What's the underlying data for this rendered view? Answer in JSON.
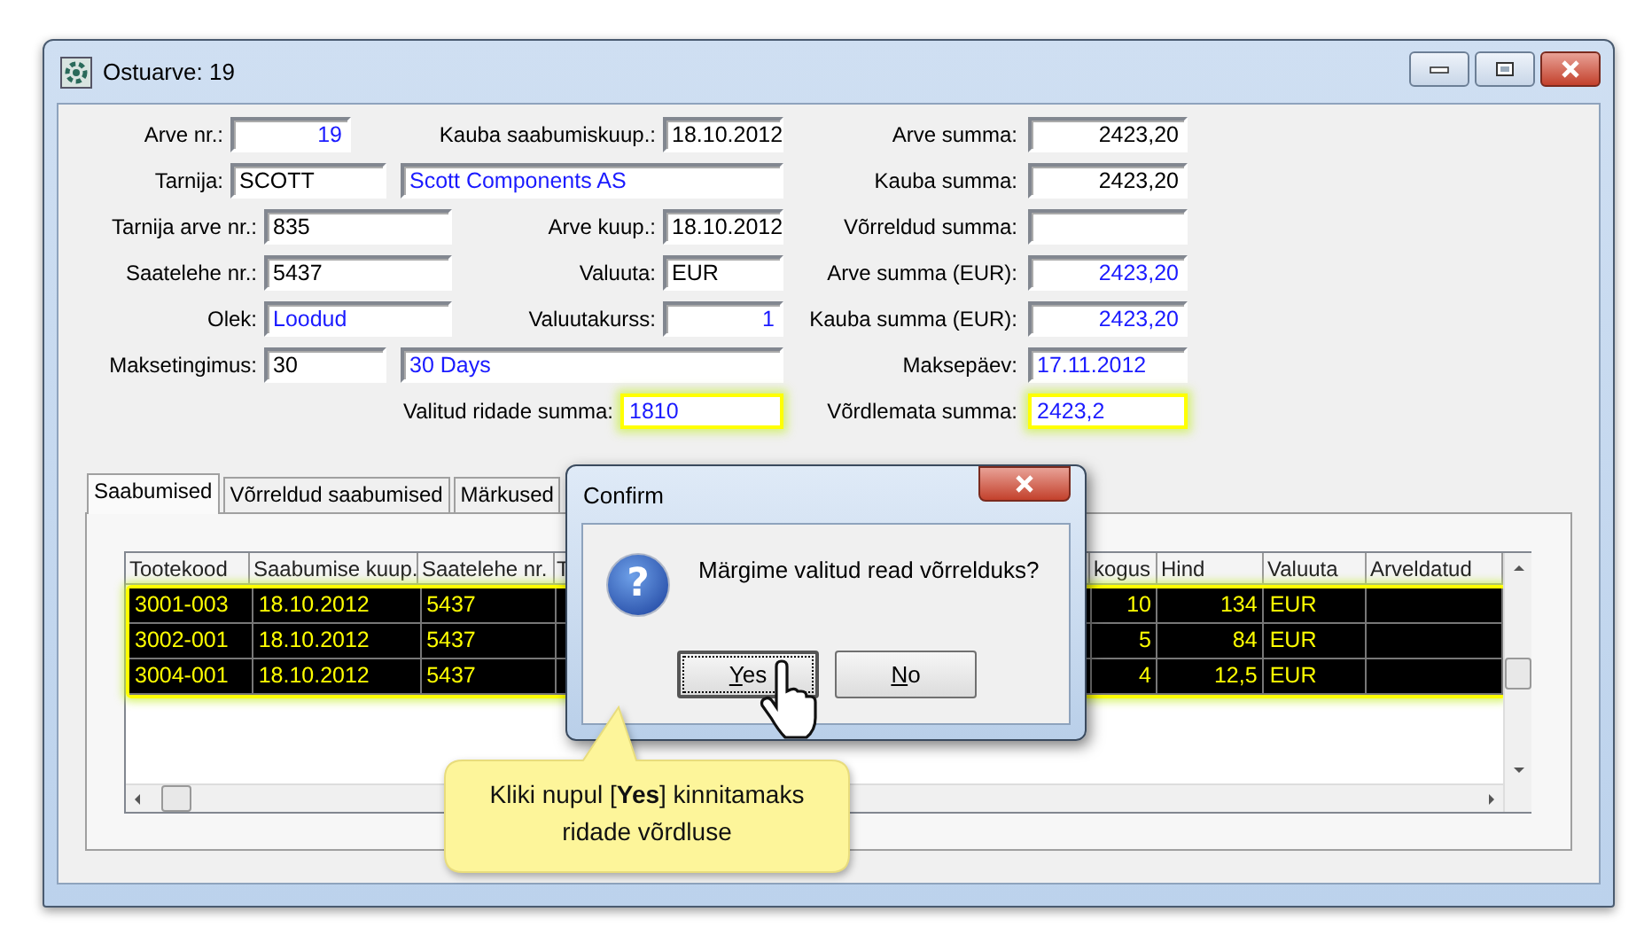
{
  "window": {
    "title": "Ostuarve: 19"
  },
  "form": {
    "left_rows": [
      [
        {
          "kind": "label",
          "text": "Arve nr.:"
        },
        {
          "kind": "number-field",
          "value": "19",
          "readonly": true,
          "highlighted": false
        },
        {
          "kind": "label",
          "text": "Kauba saabumiskuup.:"
        },
        {
          "kind": "field",
          "value": "18.10.2012",
          "readonly": false,
          "highlighted": false
        }
      ],
      [
        {
          "kind": "label",
          "text": "Tarnija:"
        },
        {
          "kind": "field",
          "value": "SCOTT",
          "readonly": false,
          "highlighted": false
        },
        {
          "kind": "field",
          "value": "Scott Components AS",
          "readonly": true,
          "highlighted": false
        }
      ],
      [
        {
          "kind": "label",
          "text": "Tarnija arve nr.:"
        },
        {
          "kind": "field",
          "value": "835",
          "readonly": false,
          "highlighted": false
        },
        {
          "kind": "label",
          "text": "Arve kuup.:"
        },
        {
          "kind": "field",
          "value": "18.10.2012",
          "readonly": false,
          "highlighted": false
        }
      ],
      [
        {
          "kind": "label",
          "text": "Saatelehe nr.:"
        },
        {
          "kind": "field",
          "value": "5437",
          "readonly": false,
          "highlighted": false
        },
        {
          "kind": "label",
          "text": "Valuuta:"
        },
        {
          "kind": "field",
          "value": "EUR",
          "readonly": false,
          "highlighted": false
        }
      ],
      [
        {
          "kind": "label",
          "text": "Olek:"
        },
        {
          "kind": "field",
          "value": "Loodud",
          "readonly": true,
          "highlighted": false
        },
        {
          "kind": "label",
          "text": "Valuutakurss:"
        },
        {
          "kind": "number-field",
          "value": "1",
          "readonly": true,
          "highlighted": false
        }
      ],
      [
        {
          "kind": "label",
          "text": "Maksetingimus:"
        },
        {
          "kind": "field",
          "value": "30",
          "readonly": false,
          "highlighted": false
        },
        {
          "kind": "field",
          "value": "30 Days",
          "readonly": true,
          "highlighted": false
        }
      ],
      [
        {
          "kind": "label",
          "text": "Valitud ridade summa:"
        },
        {
          "kind": "field",
          "value": "1810",
          "readonly": true,
          "highlighted": true
        }
      ]
    ],
    "right_rows": [
      [
        {
          "kind": "label",
          "text": "Arve summa:"
        },
        {
          "kind": "number-field",
          "value": "2423,20",
          "readonly": false,
          "highlighted": false
        }
      ],
      [
        {
          "kind": "label",
          "text": "Kauba summa:"
        },
        {
          "kind": "number-field",
          "value": "2423,20",
          "readonly": false,
          "highlighted": false
        }
      ],
      [
        {
          "kind": "label",
          "text": "Võrreldud summa:"
        },
        {
          "kind": "number-field",
          "highlighted": false
        }
      ],
      [
        {
          "kind": "label",
          "text": "Arve summa (EUR):"
        },
        {
          "kind": "number-field",
          "value": "2423,20",
          "readonly": true,
          "highlighted": false
        }
      ],
      [
        {
          "kind": "label",
          "text": "Kauba summa (EUR):"
        },
        {
          "kind": "number-field",
          "value": "2423,20",
          "readonly": true,
          "highlighted": false
        }
      ],
      [
        {
          "kind": "label",
          "text": "Maksepäev:"
        },
        {
          "kind": "field",
          "value": "17.11.2012",
          "readonly": true,
          "highlighted": false
        }
      ],
      [
        {
          "kind": "label",
          "text": "Võrdlemata summa:"
        },
        {
          "kind": "field",
          "value": "2423,2",
          "readonly": true,
          "highlighted": true
        }
      ]
    ]
  },
  "tabs": [
    {
      "label": "Saabumised",
      "selected": true
    },
    {
      "label": "Võrreldud saabumised",
      "selected": false
    },
    {
      "label": "Märkused",
      "selected": false
    }
  ],
  "table": {
    "highlighted": true,
    "columns": [
      {
        "label": "Tootekood",
        "kind": "text"
      },
      {
        "label": "Saabumise kuup.",
        "kind": "text"
      },
      {
        "label": "Saatelehe nr.",
        "kind": "text"
      },
      {
        "label": "T",
        "kind": "text"
      },
      {
        "label": "kogus",
        "kind": "number"
      },
      {
        "label": "Hind",
        "kind": "number"
      },
      {
        "label": "Valuuta",
        "kind": "text"
      },
      {
        "label": "Arveldatud",
        "kind": "text"
      }
    ],
    "rows": [
      {
        "selected": true,
        "cells": [
          "3001-003",
          "18.10.2012",
          "5437",
          null,
          "10",
          "134",
          "EUR",
          null
        ]
      },
      {
        "selected": true,
        "cells": [
          "3002-001",
          "18.10.2012",
          "5437",
          null,
          "5",
          "84",
          "EUR",
          null
        ]
      },
      {
        "selected": true,
        "cells": [
          "3004-001",
          "18.10.2012",
          "5437",
          null,
          "4",
          "12,5",
          "EUR",
          null
        ]
      }
    ]
  },
  "dialog": {
    "title": "Confirm",
    "icon_glyph": "?",
    "message": "Märgime valitud read võrrelduks?",
    "buttons": [
      {
        "label": "Yes",
        "focused": true
      },
      {
        "label": "No",
        "focused": false
      }
    ]
  },
  "callout": {
    "text": "Kliki nupul [**Yes**] kinnitamaks ridade võrdluse"
  }
}
